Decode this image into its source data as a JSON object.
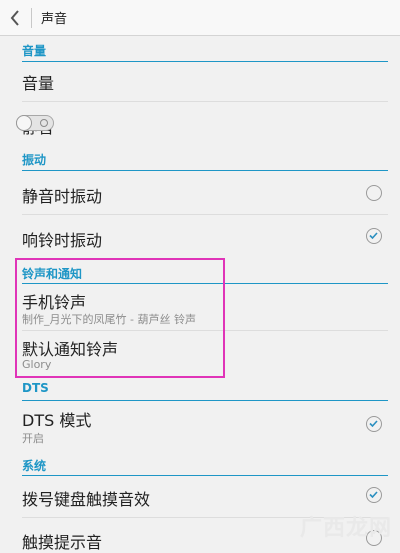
{
  "header": {
    "title": "声音",
    "back_icon": "chevron-left-icon"
  },
  "sections": {
    "volume": {
      "header": "音量",
      "items": {
        "volume": {
          "title": "音量"
        },
        "mute": {
          "title": "静音",
          "toggle_on": false
        }
      }
    },
    "vibrate": {
      "header": "振动",
      "items": {
        "vibrate_silent": {
          "title": "静音时振动",
          "checked": false
        },
        "vibrate_ring": {
          "title": "响铃时振动",
          "checked": true
        }
      }
    },
    "ringtone": {
      "header": "铃声和通知",
      "items": {
        "phone_ringtone": {
          "title": "手机铃声",
          "subtitle": "制作_月光下的凤尾竹 - 葫芦丝 铃声"
        },
        "notification_ringtone": {
          "title": "默认通知铃声",
          "subtitle": "Glory"
        }
      }
    },
    "dts": {
      "header": "DTS",
      "items": {
        "dts_mode": {
          "title": "DTS 模式",
          "subtitle": "开启",
          "checked": true
        }
      }
    },
    "system": {
      "header": "系统",
      "items": {
        "dial_pad_sound": {
          "title": "拨号键盘触摸音效",
          "checked": true
        },
        "touch_sound": {
          "title": "触摸提示音",
          "checked": false
        }
      }
    }
  },
  "colors": {
    "accent": "#1e96c6",
    "highlight": "#e034b8"
  },
  "watermark": {
    "text": "广西龙网"
  }
}
